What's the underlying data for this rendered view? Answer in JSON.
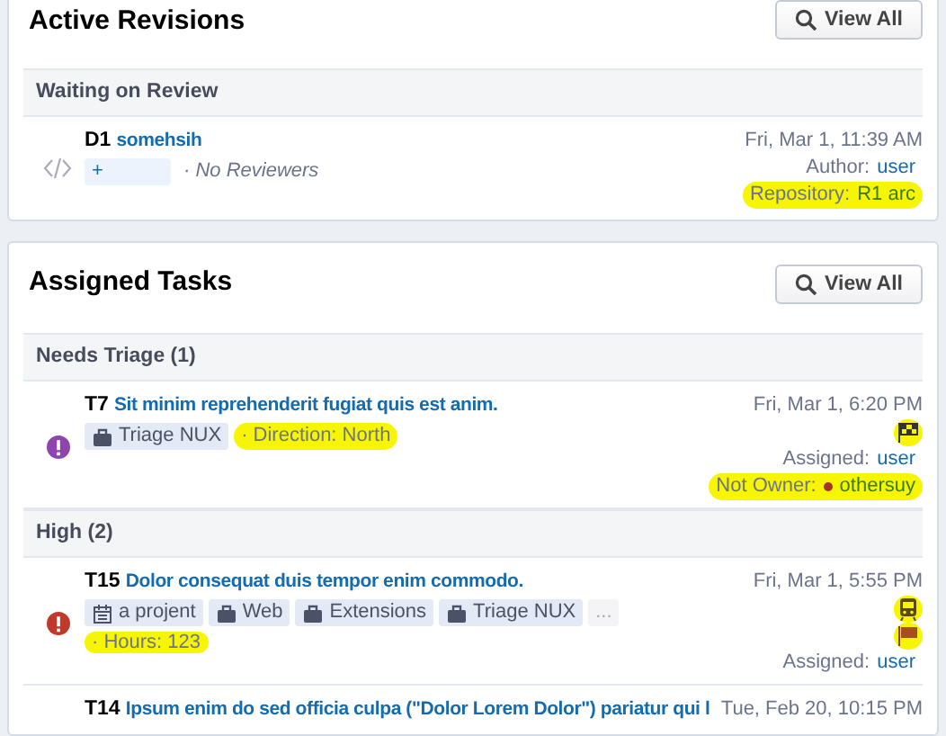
{
  "panels": [
    {
      "title": "Active Revisions",
      "button": "View All",
      "groups": [
        {
          "title": "Waiting on Review",
          "items": [
            {
              "kind": "revision",
              "id": "D1",
              "title": "somehsih",
              "date": "Fri, Mar 1, 11:39 AM",
              "tags": [
                {
                  "kind": "plus",
                  "label": "+"
                }
              ],
              "attributes": [
                {
                  "text": "· No Reviewers",
                  "italic": true,
                  "highlighted": false
                }
              ],
              "meta": [
                {
                  "label": "Author:",
                  "value": "user",
                  "highlighted": false
                },
                {
                  "label": "Repository:",
                  "value": "R1 arc",
                  "highlighted": true
                }
              ]
            }
          ]
        }
      ]
    },
    {
      "title": "Assigned Tasks",
      "button": "View All",
      "groups": [
        {
          "title": "Needs Triage (1)",
          "items": [
            {
              "kind": "task",
              "color": "#8e44ad",
              "id": "T7",
              "title": "Sit minim reprehenderit fugiat quis est anim.",
              "date": "Fri, Mar 1, 6:20 PM",
              "tags": [
                {
                  "kind": "briefcase",
                  "label": "Triage NUX"
                }
              ],
              "attributes": [
                {
                  "text": "· Direction: North",
                  "italic": false,
                  "highlighted": true
                }
              ],
              "icons": [
                {
                  "kind": "checkered-flag",
                  "highlighted": true
                }
              ],
              "meta": [
                {
                  "label": "Assigned:",
                  "value": "user",
                  "highlighted": false
                },
                {
                  "label": "Not Owner:",
                  "value": "othersuy",
                  "highlighted": true,
                  "color": "#a93226"
                }
              ]
            }
          ]
        },
        {
          "title": "High (2)",
          "items": [
            {
              "kind": "task",
              "color": "#c0392b",
              "id": "T15",
              "title": "Dolor consequat duis tempor enim commodo.",
              "date": "Fri, Mar 1, 5:55 PM",
              "tags": [
                {
                  "kind": "calendar",
                  "label": "a projent"
                },
                {
                  "kind": "briefcase",
                  "label": "Web"
                },
                {
                  "kind": "briefcase",
                  "label": "Extensions"
                },
                {
                  "kind": "briefcase",
                  "label": "Triage NUX"
                },
                {
                  "kind": "more",
                  "label": "..."
                }
              ],
              "attributes": [
                {
                  "text": "· Hours: 123",
                  "italic": false,
                  "highlighted": true,
                  "own_line": true
                }
              ],
              "icons": [
                {
                  "kind": "train",
                  "highlighted": true
                },
                {
                  "kind": "flag",
                  "highlighted": true
                }
              ],
              "meta": [
                {
                  "label": "Assigned:",
                  "value": "user",
                  "highlighted": false
                }
              ]
            },
            {
              "kind": "task-partial",
              "id": "T14",
              "title": "Ipsum enim do sed officia culpa (\"Dolor Lorem Dolor\") pariatur qui l",
              "date": "Tue, Feb 20, 10:15 PM"
            }
          ]
        }
      ]
    }
  ]
}
